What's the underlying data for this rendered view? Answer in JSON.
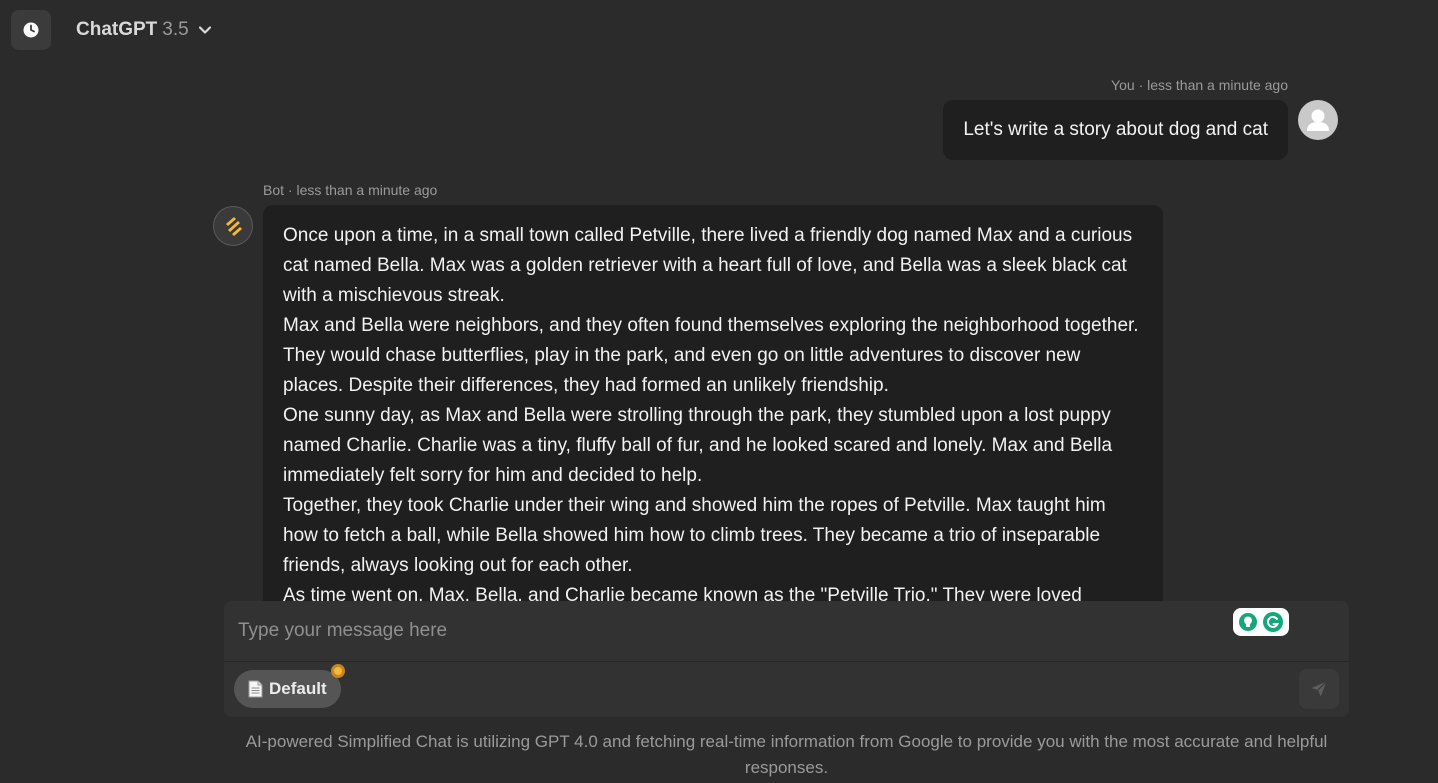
{
  "header": {
    "history_icon": "clock-icon",
    "model_name": "ChatGPT",
    "model_version": "3.5",
    "dropdown_icon": "chevron-down-icon"
  },
  "messages": {
    "user": {
      "sender": "You",
      "separator": "·",
      "time": "less than a minute ago",
      "text": "Let's write a story about dog and cat",
      "avatar_icon": "user-avatar-icon"
    },
    "bot": {
      "sender": "Bot",
      "separator": "·",
      "time": "less than a minute ago",
      "avatar_icon": "bot-logo-icon",
      "paragraphs": [
        "Once upon a time, in a small town called Petville, there lived a friendly dog named Max and a curious cat named Bella. Max was a golden retriever with a heart full of love, and Bella was a sleek black cat with a mischievous streak.",
        "Max and Bella were neighbors, and they often found themselves exploring the neighborhood together. They would chase butterflies, play in the park, and even go on little adventures to discover new places. Despite their differences, they had formed an unlikely friendship.",
        "One sunny day, as Max and Bella were strolling through the park, they stumbled upon a lost puppy named Charlie. Charlie was a tiny, fluffy ball of fur, and he looked scared and lonely. Max and Bella immediately felt sorry for him and decided to help.",
        "Together, they took Charlie under their wing and showed him the ropes of Petville. Max taught him how to fetch a ball, while Bella showed him how to climb trees. They became a trio of inseparable friends, always looking out for each other.",
        "As time went on, Max, Bella, and Charlie became known as the \"Petville Trio.\" They were loved"
      ]
    }
  },
  "composer": {
    "placeholder": "Type your message here",
    "value": "",
    "chip_label": "Default",
    "chip_icon": "document-icon",
    "send_icon": "send-icon",
    "grammarly_icons": [
      "lightbulb-icon",
      "grammarly-icon"
    ]
  },
  "footer": {
    "disclaimer": "AI-powered Simplified Chat is utilizing GPT 4.0 and fetching real-time information from Google to provide you with the most accurate and helpful responses."
  },
  "colors": {
    "background": "#2b2b2b",
    "bubble": "#1f1f1f",
    "composer": "#323232",
    "chip": "#555555",
    "accent": "#f4b93a",
    "grammarly_green": "#15a67c"
  }
}
